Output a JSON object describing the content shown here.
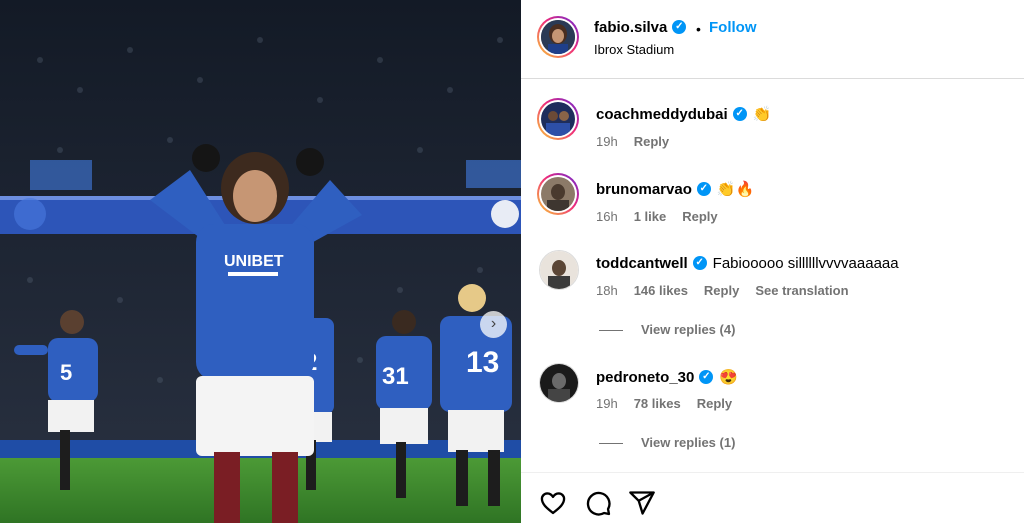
{
  "post": {
    "username": "fabio.silva",
    "follow_label": "Follow",
    "location": "Ibrox Stadium",
    "separator": "•"
  },
  "photo": {
    "sponsor_text": "UNIBET",
    "numbers": [
      "5",
      "2",
      "31",
      "13"
    ]
  },
  "comments": [
    {
      "username": "coachmeddydubai",
      "text": "👏",
      "time": "19h",
      "likes": "",
      "reply": "Reply"
    },
    {
      "username": "brunomarvao",
      "text": "👏🔥",
      "time": "16h",
      "likes": "1 like",
      "reply": "Reply"
    },
    {
      "username": "toddcantwell",
      "text": "Fabiooooo sillllllvvvvaaaaaa",
      "time": "18h",
      "likes": "146 likes",
      "reply": "Reply",
      "translate": "See translation",
      "view_replies": "View replies (4)"
    },
    {
      "username": "pedroneto_30",
      "text": "😍",
      "time": "19h",
      "likes": "78 likes",
      "reply": "Reply",
      "view_replies": "View replies (1)"
    }
  ],
  "icons": [
    "heart-icon",
    "comment-icon",
    "share-icon"
  ],
  "colors": {
    "link": "#0095f6",
    "muted": "#737373",
    "kit_blue": "#2f5fc0",
    "pitch": "#3f8a2e"
  }
}
